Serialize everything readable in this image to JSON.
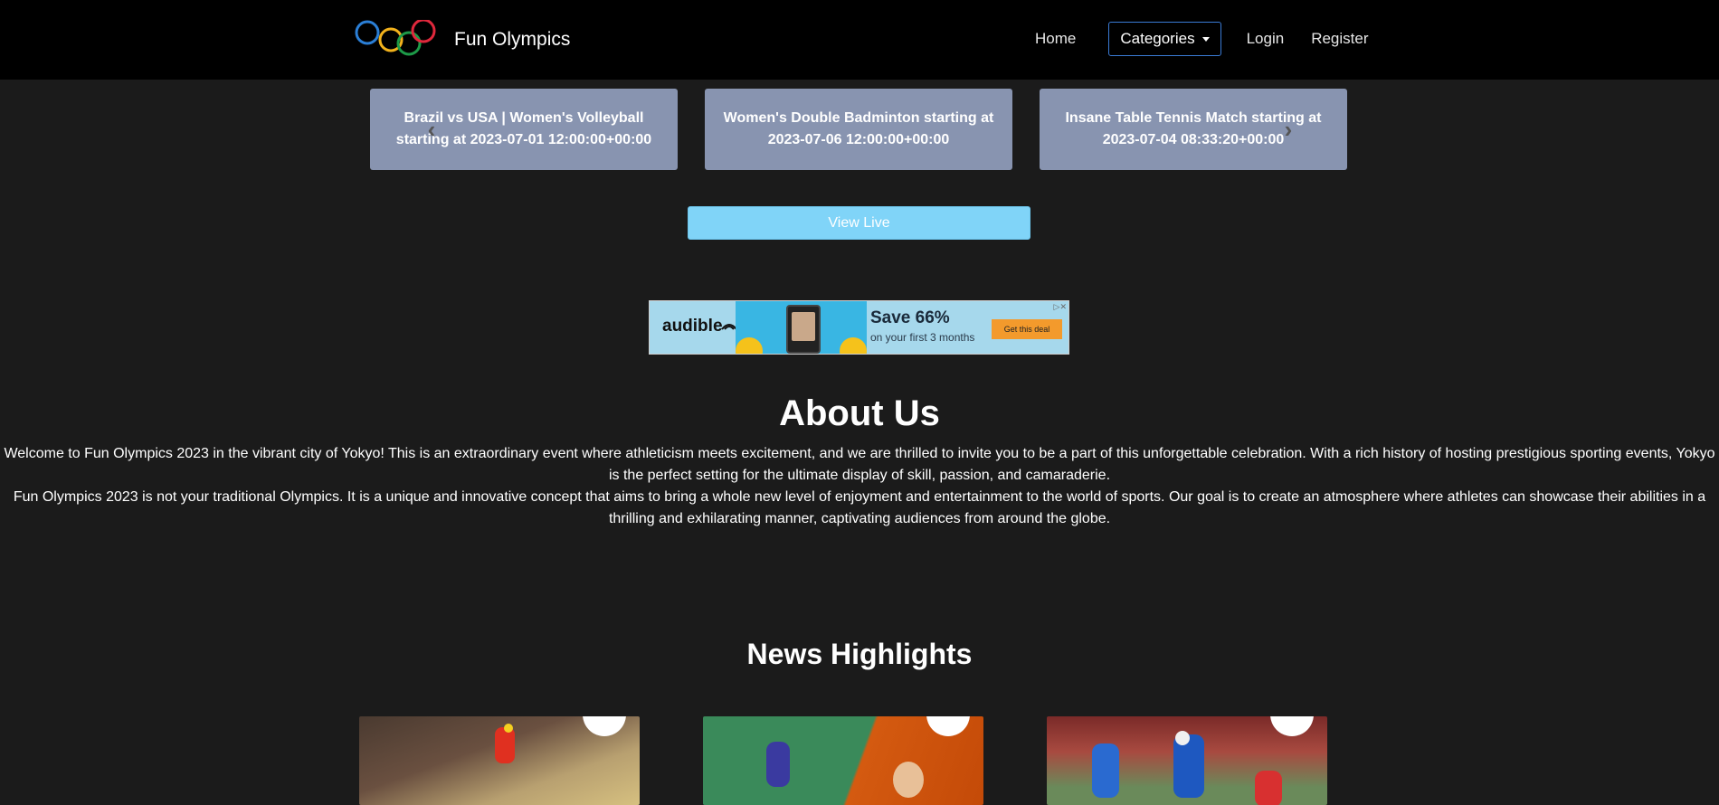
{
  "navbar": {
    "brand_name": "Fun Olympics",
    "links": {
      "home": "Home",
      "categories": "Categories",
      "login": "Login",
      "register": "Register"
    }
  },
  "carousel": {
    "slides": [
      "Brazil vs USA | Women's Volleyball starting at 2023-07-01 12:00:00+00:00",
      "Women's Double Badminton starting at 2023-07-06 12:00:00+00:00",
      "Insane Table Tennis Match starting at 2023-07-04 08:33:20+00:00"
    ],
    "prev_icon": "chevron-left",
    "next_icon": "chevron-right"
  },
  "view_live_label": "View Live",
  "ad": {
    "brand": "audible",
    "headline": "Save 66%",
    "subtext": "on your first 3 months",
    "cta": "Get this deal"
  },
  "about": {
    "title": "About Us",
    "paragraph_1": "Welcome to Fun Olympics 2023 in the vibrant city of Yokyo! This is an extraordinary event where athleticism meets excitement, and we are thrilled to invite you to be a part of this unforgettable celebration. With a rich history of hosting prestigious sporting events, Yokyo is the perfect setting for the ultimate display of skill, passion, and camaraderie.",
    "paragraph_2": "Fun Olympics 2023 is not your traditional Olympics. It is a unique and innovative concept that aims to bring a whole new level of enjoyment and entertainment to the world of sports. Our goal is to create an atmosphere where athletes can showcase their abilities in a thrilling and exhilarating manner, captivating audiences from around the globe."
  },
  "news": {
    "title": "News Highlights"
  },
  "colors": {
    "navbar_bg": "#000000",
    "page_bg": "#1b1b1b",
    "slide_bg": "#8894b0",
    "view_live_bg": "#80d4f8",
    "categories_border": "#3a7bd5"
  }
}
